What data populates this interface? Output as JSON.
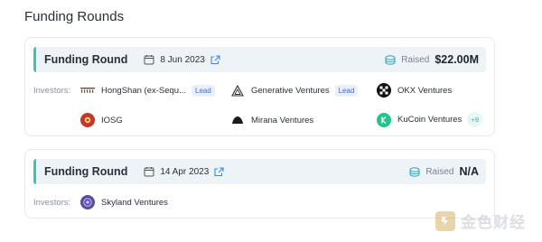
{
  "section": {
    "title": "Funding Rounds"
  },
  "rounds": [
    {
      "label": "Funding Round",
      "date": "8 Jun 2023",
      "raised_label": "Raised",
      "raised_value": "$22.00M",
      "investors_label": "Investors:",
      "investors": [
        {
          "name": "HongShan (ex-Sequ...",
          "badge": "Lead"
        },
        {
          "name": "Generative Ventures",
          "badge": "Lead"
        },
        {
          "name": "OKX Ventures"
        },
        {
          "name": "IOSG"
        },
        {
          "name": "Mirana Ventures"
        },
        {
          "name": "KuCoin Ventures",
          "more": "+9"
        }
      ]
    },
    {
      "label": "Funding Round",
      "date": "14 Apr 2023",
      "raised_label": "Raised",
      "raised_value": "N/A",
      "investors_label": "Investors:",
      "investors": [
        {
          "name": "Skyland Ventures"
        }
      ]
    }
  ],
  "watermark": {
    "text": "金色财经"
  },
  "colors": {
    "accent": "#3fc4b0",
    "lead_badge": "#3b6fd8",
    "header_bg": "#eef3f8"
  }
}
